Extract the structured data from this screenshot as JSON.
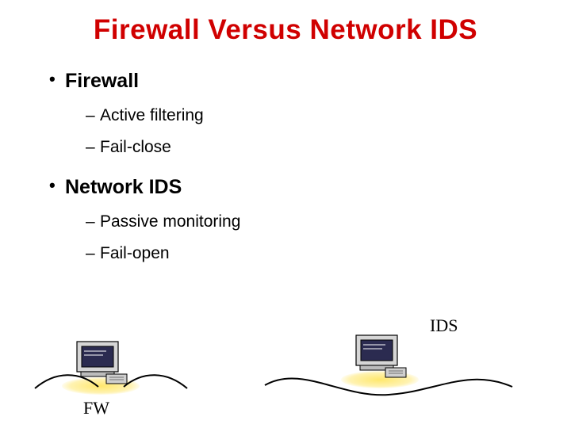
{
  "title": "Firewall Versus Network IDS",
  "bullets": {
    "b1": "Firewall",
    "b1s1": "Active filtering",
    "b1s2": "Fail-close",
    "b2": "Network IDS",
    "b2s1": "Passive monitoring",
    "b2s2": "Fail-open"
  },
  "labels": {
    "ids": "IDS",
    "fw": "FW"
  }
}
